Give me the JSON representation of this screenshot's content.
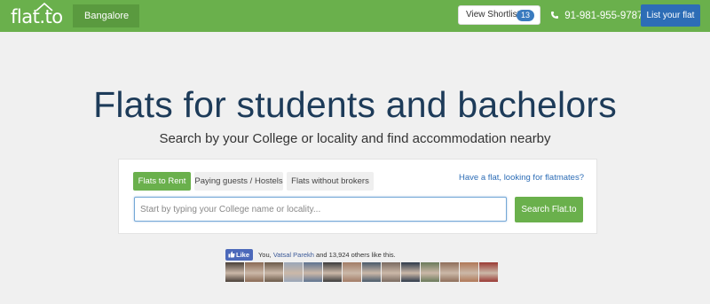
{
  "header": {
    "logo_text": "flat.to",
    "city": "Bangalore",
    "shortlist_label": "View Shortlist",
    "shortlist_count": "13",
    "phone": "91-981-955-9787",
    "list_flat_label": "List your flat",
    "colors": {
      "bar": "#6ab04c",
      "city_btn": "#5a9a3f",
      "list_btn": "#2d6db6",
      "badge": "#3a7bbf"
    }
  },
  "hero": {
    "title": "Flats for students and bachelors",
    "subtitle": "Search by your College or locality and find accommodation nearby"
  },
  "search": {
    "tabs": [
      {
        "label": "Flats to Rent",
        "active": true
      },
      {
        "label": "Paying guests / Hostels",
        "active": false
      },
      {
        "label": "Flats without brokers",
        "active": false
      }
    ],
    "flatmate_link": "Have a flat, looking for flatmates?",
    "placeholder": "Start by typing your College name or locality...",
    "value": "",
    "button_label": "Search Flat.to"
  },
  "social": {
    "like_label": "Like",
    "prefix": "You,",
    "friend_name": "Vatsal Parekh",
    "suffix": "and 13,924 others like this.",
    "faces": [
      {
        "icon": "avatar",
        "color": "#4a4038"
      },
      {
        "icon": "avatar",
        "color": "#8a6a55"
      },
      {
        "icon": "avatar",
        "color": "#6b5a4a"
      },
      {
        "icon": "avatar",
        "color": "#9aa6b8"
      },
      {
        "icon": "avatar",
        "color": "#5e7390"
      },
      {
        "icon": "avatar",
        "color": "#3c3c3c"
      },
      {
        "icon": "avatar",
        "color": "#a27c66"
      },
      {
        "icon": "avatar",
        "color": "#4a5a6a"
      },
      {
        "icon": "avatar",
        "color": "#7a6a60"
      },
      {
        "icon": "avatar",
        "color": "#2e3a4a"
      },
      {
        "icon": "avatar",
        "color": "#6a7a5a"
      },
      {
        "icon": "avatar",
        "color": "#8e6e5a"
      },
      {
        "icon": "avatar",
        "color": "#b07858"
      },
      {
        "icon": "avatar",
        "color": "#9a3a34"
      }
    ]
  }
}
